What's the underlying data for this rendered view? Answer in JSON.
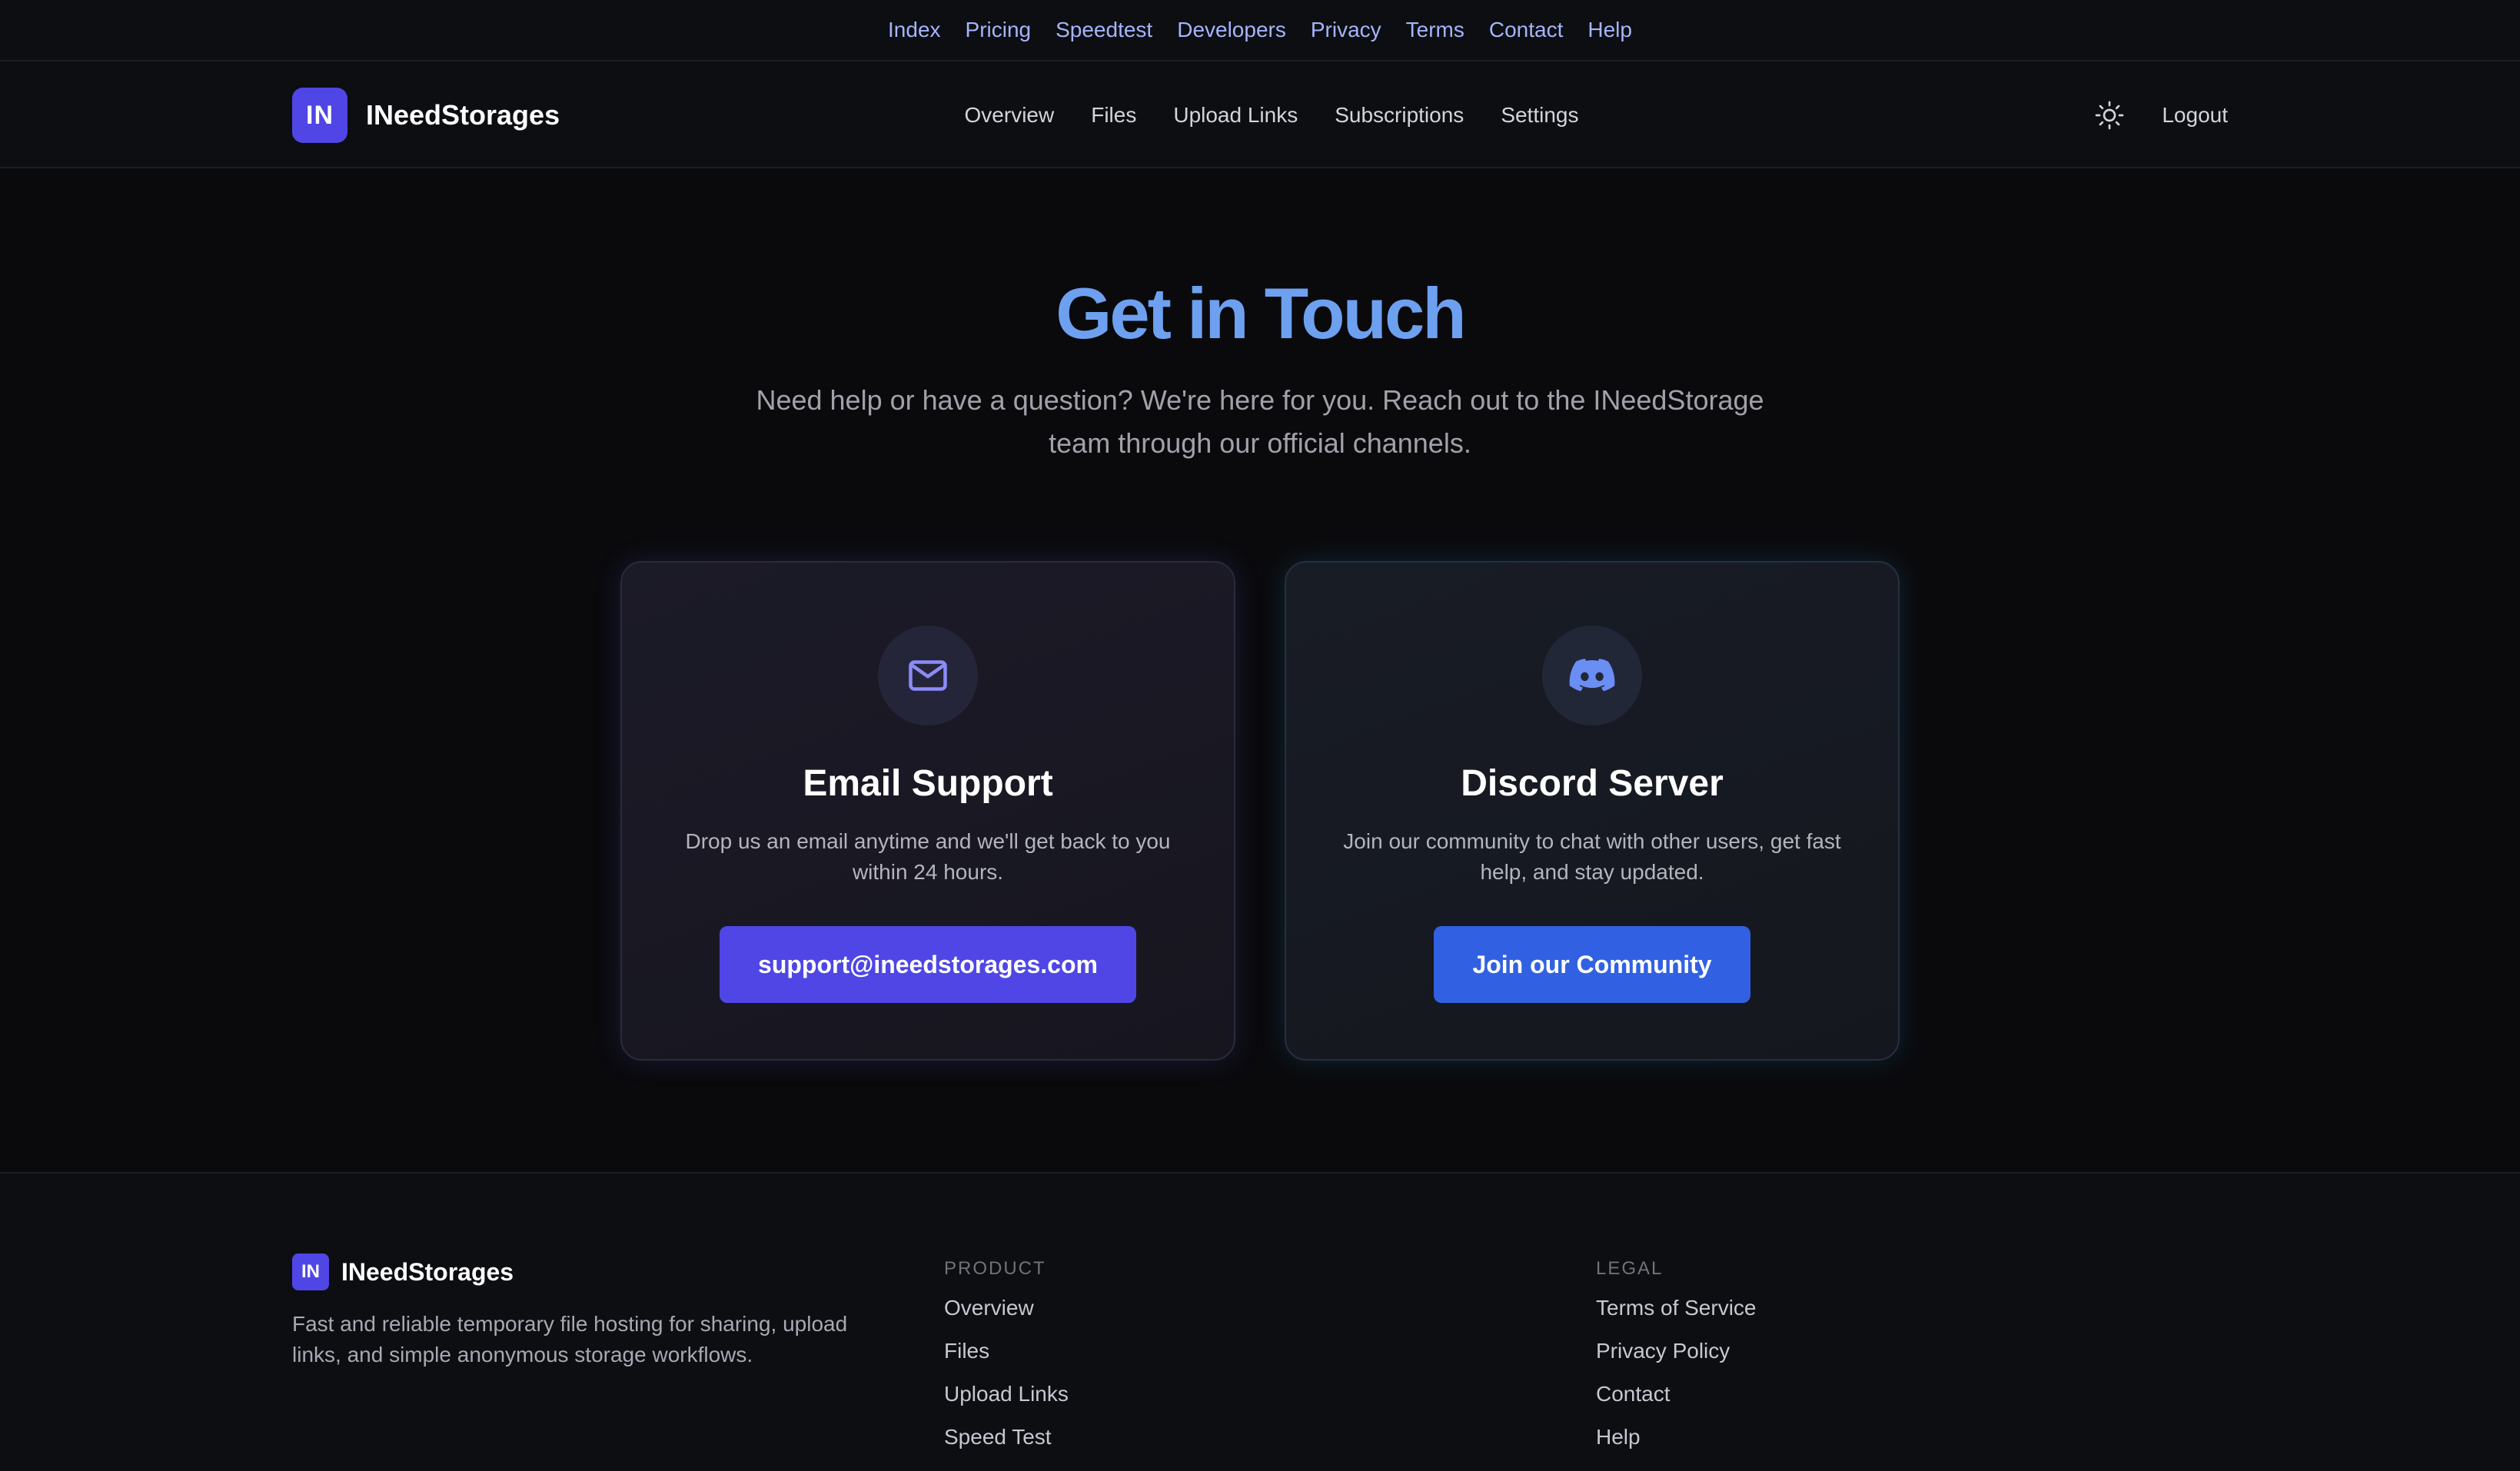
{
  "topbar": {
    "links": [
      "Index",
      "Pricing",
      "Speedtest",
      "Developers",
      "Privacy",
      "Terms",
      "Contact",
      "Help"
    ]
  },
  "nav": {
    "logo_text": "IN",
    "brand": "INeedStorages",
    "links": [
      "Overview",
      "Files",
      "Upload Links",
      "Subscriptions",
      "Settings"
    ],
    "theme_icon": "sun-icon",
    "logout": "Logout"
  },
  "hero": {
    "title": "Get in Touch",
    "subtitle": "Need help or have a question? We're here for you. Reach out to the INeedStorage team through our official channels."
  },
  "cards": {
    "email": {
      "icon": "mail-icon",
      "title": "Email Support",
      "description": "Drop us an email anytime and we'll get back to you within 24 hours.",
      "button": "support@ineedstorages.com"
    },
    "discord": {
      "icon": "discord-icon",
      "title": "Discord Server",
      "description": "Join our community to chat with other users, get fast help, and stay updated.",
      "button": "Join our Community"
    }
  },
  "footer": {
    "logo_text": "IN",
    "brand": "INeedStorages",
    "description": "Fast and reliable temporary file hosting for sharing, upload links, and simple anonymous storage workflows.",
    "product_heading": "PRODUCT",
    "product_links": [
      "Overview",
      "Files",
      "Upload Links",
      "Speed Test"
    ],
    "legal_heading": "LEGAL",
    "legal_links": [
      "Terms of Service",
      "Privacy Policy",
      "Contact",
      "Help"
    ]
  },
  "colors": {
    "background": "#0a0a0d",
    "accent_indigo": "#4f46e5",
    "accent_blue": "#3161e2",
    "title_blue": "#6ea0f0",
    "topbar_link": "#a5b4fc"
  }
}
